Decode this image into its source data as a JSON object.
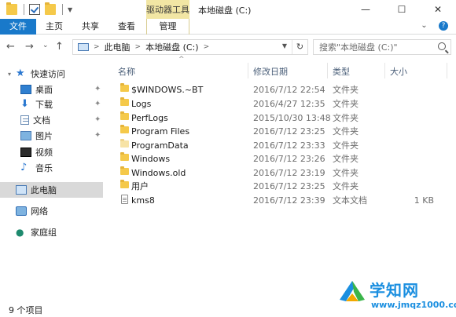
{
  "titlebar": {
    "context_tab": "驱动器工具",
    "title": "本地磁盘 (C:)",
    "minimize": "—",
    "maximize": "☐",
    "close": "✕"
  },
  "ribbon": {
    "tabs": [
      {
        "label": "文件"
      },
      {
        "label": "主页"
      },
      {
        "label": "共享"
      },
      {
        "label": "查看"
      },
      {
        "label": "管理"
      }
    ],
    "expand": "⌄",
    "help": "?"
  },
  "nav": {
    "back": "←",
    "forward": "→",
    "recent": "⌄",
    "up": "↑"
  },
  "address": {
    "crumbs": [
      "此电脑",
      "本地磁盘 (C:)"
    ],
    "separator": ">",
    "refresh": "↻"
  },
  "search": {
    "placeholder": "搜索\"本地磁盘 (C:)\""
  },
  "navpane": {
    "quick_access": "快速访问",
    "items": [
      {
        "label": "桌面",
        "icon": "desktop-icon",
        "pinned": true
      },
      {
        "label": "下载",
        "icon": "download-icon",
        "pinned": true
      },
      {
        "label": "文档",
        "icon": "document-icon",
        "pinned": true
      },
      {
        "label": "图片",
        "icon": "picture-icon",
        "pinned": true
      },
      {
        "label": "视频",
        "icon": "video-icon",
        "pinned": false
      },
      {
        "label": "音乐",
        "icon": "music-icon",
        "pinned": false
      }
    ],
    "this_pc": "此电脑",
    "network": "网络",
    "homegroup": "家庭组"
  },
  "columns": {
    "name": "名称",
    "date": "修改日期",
    "type": "类型",
    "size": "大小"
  },
  "files": [
    {
      "name": "$WINDOWS.~BT",
      "date": "2016/7/12 22:54",
      "type": "文件夹",
      "size": "",
      "icon": "folder-icon"
    },
    {
      "name": "Logs",
      "date": "2016/4/27 12:35",
      "type": "文件夹",
      "size": "",
      "icon": "folder-icon"
    },
    {
      "name": "PerfLogs",
      "date": "2015/10/30 13:48",
      "type": "文件夹",
      "size": "",
      "icon": "folder-icon"
    },
    {
      "name": "Program Files",
      "date": "2016/7/12 23:25",
      "type": "文件夹",
      "size": "",
      "icon": "folder-icon"
    },
    {
      "name": "ProgramData",
      "date": "2016/7/12 23:33",
      "type": "文件夹",
      "size": "",
      "icon": "folder-icon"
    },
    {
      "name": "Windows",
      "date": "2016/7/12 23:26",
      "type": "文件夹",
      "size": "",
      "icon": "folder-icon"
    },
    {
      "name": "Windows.old",
      "date": "2016/7/12 23:19",
      "type": "文件夹",
      "size": "",
      "icon": "folder-icon"
    },
    {
      "name": "用户",
      "date": "2016/7/12 23:25",
      "type": "文件夹",
      "size": "",
      "icon": "folder-icon"
    },
    {
      "name": "kms8",
      "date": "2016/7/12 23:39",
      "type": "文本文档",
      "size": "1 KB",
      "icon": "text-file-icon"
    }
  ],
  "status": {
    "count": "9 个项目"
  },
  "watermark": {
    "text": "学知网",
    "url": "www.jmqz1000.com"
  },
  "colors": {
    "accent": "#1979ca",
    "context_tab": "#f2e6a4",
    "folder": "#f5c94a",
    "selected": "#d9d9d9"
  }
}
